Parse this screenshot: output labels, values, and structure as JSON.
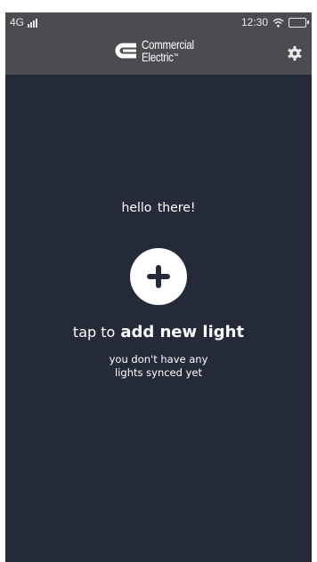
{
  "status_bar": {
    "network": "4G",
    "time": "12:30"
  },
  "header": {
    "brand_line1": "Commercial",
    "brand_line2": "Electric",
    "brand_tm": "™",
    "settings_icon": "gear-icon"
  },
  "main": {
    "greeting": "hello there!",
    "add_icon": "plus-icon",
    "cta_prefix": "tap to",
    "cta_action": "add new light",
    "empty_line1": "you don't have any",
    "empty_line2": "lights synced yet"
  },
  "colors": {
    "background": "#252a39",
    "header": "#4a4c4f",
    "text": "#ffffff",
    "icon": "#252a39"
  }
}
